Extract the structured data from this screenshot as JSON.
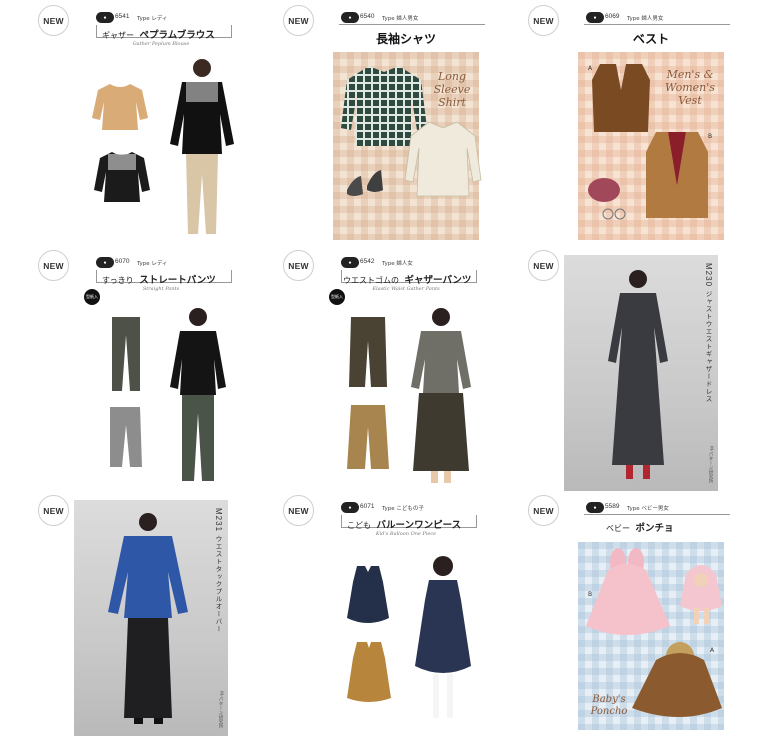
{
  "badge_label": "NEW",
  "cards": [
    {
      "number": "6541",
      "type_label": "Type レディ",
      "title_prefix": "ギャザー",
      "title_main": "ペプラムブラウス",
      "subtitle_en": "Gather Peplum Blouse"
    },
    {
      "number": "6540",
      "type_label": "Type 婦人男女",
      "title_main": "長袖シャツ",
      "script": "Long Sleeve Shirt"
    },
    {
      "number": "6069",
      "type_label": "Type 婦人男女",
      "title_main": "ベスト",
      "script": "Men's & Women's Vest",
      "marks": [
        "A",
        "B"
      ]
    },
    {
      "number": "6070",
      "type_label": "Type レディ",
      "title_prefix": "すっきり",
      "title_main": "ストレートパンツ",
      "subtitle_en": "Straight Pants",
      "dot_label": "型紙入"
    },
    {
      "number": "6542",
      "type_label": "Type 婦人女",
      "title_prefix": "ウエストゴムの",
      "title_main": "ギャザーパンツ",
      "subtitle_en": "Elastic Waist Gather Pants",
      "dot_label": "型紙入"
    },
    {
      "code": "M230",
      "vertical_title": "ジャストウエストギャザードレス",
      "credit": "M-パターン研究所"
    },
    {
      "code": "M231",
      "vertical_title": "ウエストタックプルオーバー",
      "credit": "M-パターン研究所"
    },
    {
      "number": "6071",
      "type_label": "Type こどもの子",
      "title_prefix": "こども",
      "title_main": "バルーンワンピース",
      "subtitle_en": "Kid's Balloon One Piece"
    },
    {
      "number": "5589",
      "type_label": "Type ベビー男女",
      "title_prefix": "ベビー",
      "title_main": "ポンチョ",
      "script": "Baby's Poncho",
      "marks": [
        "B",
        "A"
      ]
    }
  ]
}
